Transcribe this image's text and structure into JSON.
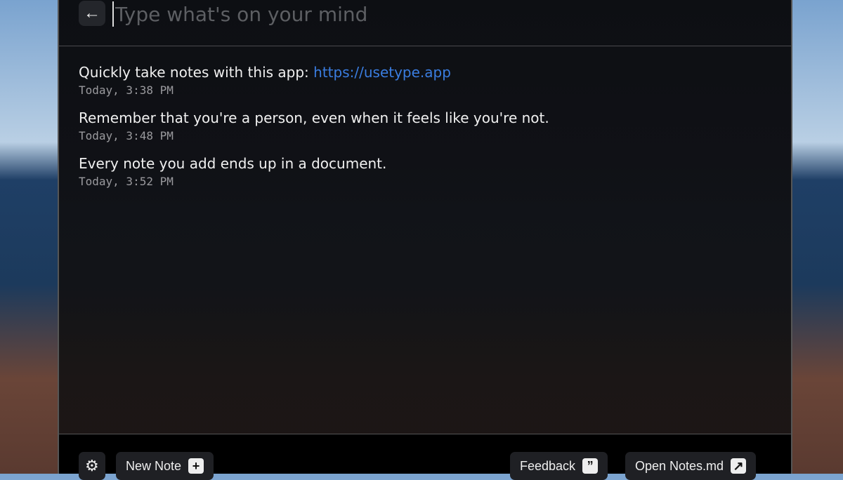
{
  "input": {
    "placeholder": "Type what's on your mind"
  },
  "notes": [
    {
      "text": "Quickly take notes with this app: ",
      "link": "https://usetype.app",
      "time": "Today, 3:38 PM"
    },
    {
      "text": "Remember that you're a person, even when it feels like you're not.",
      "time": "Today, 3:48 PM"
    },
    {
      "text": "Every note you add ends up in a document.",
      "time": "Today, 3:52 PM"
    }
  ],
  "footer": {
    "new_note": "New Note",
    "feedback": "Feedback",
    "open_notes": "Open Notes.md"
  }
}
